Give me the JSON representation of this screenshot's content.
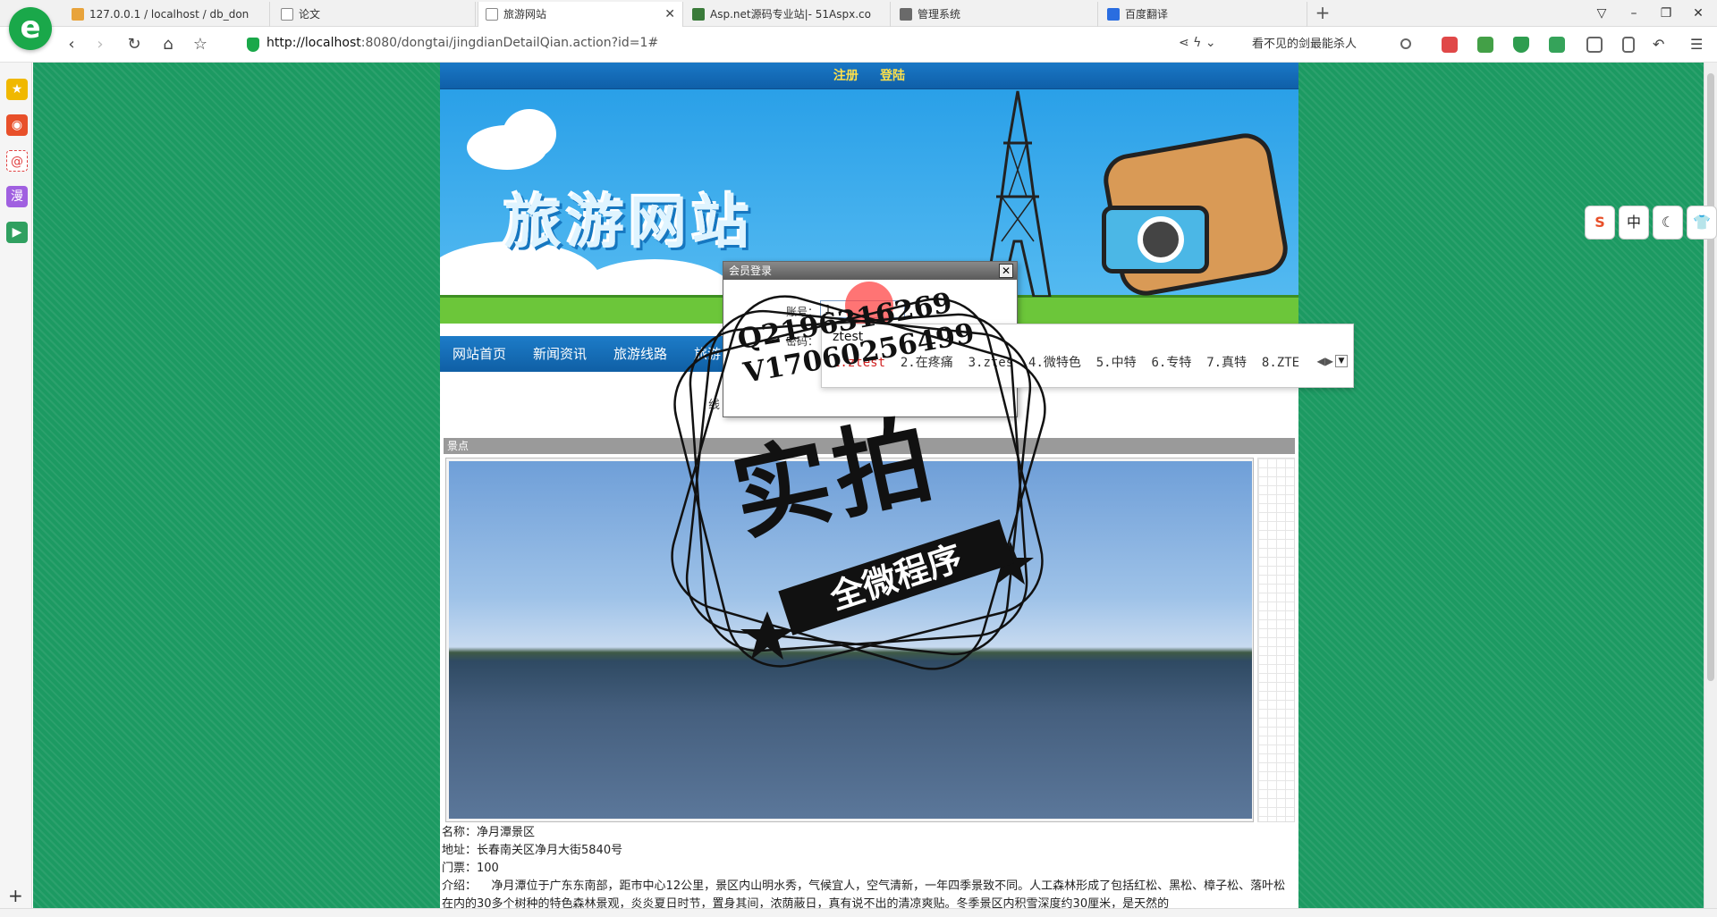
{
  "browser": {
    "tabs": [
      {
        "label": "127.0.0.1 / localhost / db_don",
        "icon": "phpmyadmin-icon",
        "color": "#e8a33b"
      },
      {
        "label": "论文",
        "icon": "document-icon",
        "color": "#9a9a9a"
      },
      {
        "label": "旅游网站",
        "icon": "document-icon",
        "color": "#9a9a9a"
      },
      {
        "label": "Asp.net源码专业站|- 51Aspx.co",
        "icon": "aspx-icon",
        "color": "#3a7b3a"
      },
      {
        "label": "管理系统",
        "icon": "chart-icon",
        "color": "#6a6a6a"
      },
      {
        "label": "百度翻译",
        "icon": "baidu-translate-icon",
        "color": "#2a6de0"
      }
    ],
    "url_host": "http://localhost",
    "url_rest": ":8080/dongtai/jingdianDetailQian.action?id=1#",
    "search_text": "看不见的剑最能杀人"
  },
  "sidebar": {
    "items": [
      {
        "name": "favorites-star-icon",
        "glyph": "★",
        "color": "#f0b800"
      },
      {
        "name": "weibo-icon",
        "glyph": "◉",
        "color": "#e8502a"
      },
      {
        "name": "mail-at-icon",
        "glyph": "@",
        "color": "#e04040"
      },
      {
        "name": "comic-icon",
        "glyph": "漫",
        "color": "#a060e0"
      },
      {
        "name": "video-icon",
        "glyph": "▶",
        "color": "#30a060"
      }
    ]
  },
  "site": {
    "topbar": {
      "register": "注册",
      "login": "登陆"
    },
    "banner_title": "旅游网站",
    "nav": [
      "网站首页",
      "新闻资讯",
      "旅游线路",
      "旅游"
    ],
    "nav_note": "线",
    "section_title": "景点",
    "details": {
      "name_label": "名称：",
      "name": "净月潭景区",
      "address_label": "地址：",
      "address": "长春南关区净月大街5840号",
      "ticket_label": "门票：",
      "ticket": "100",
      "intro_label": "介绍：",
      "intro": "净月潭位于广东东南部，距市中心12公里，景区内山明水秀，气候宜人，空气清新，一年四季景致不同。人工森林形成了包括红松、黑松、樟子松、落叶松在内的30多个树种的特色森林景观，炎炎夏日时节，置身其间，浓荫蔽日，真有说不出的清凉爽贴。冬季景区内积雪深度约30厘米，是天然的"
    }
  },
  "dialog": {
    "title": "会员登录",
    "account_label": "账号：",
    "account_value": "1",
    "password_label": "密码："
  },
  "ime": {
    "composition": "ztest",
    "candidates": [
      "1.ztest",
      "2.在疼痛",
      "3.ztes",
      "4.微特色",
      "5.中特",
      "6.专特",
      "7.真特",
      "8.ZTE"
    ]
  },
  "lang_toolbar": [
    "S",
    "中",
    "☾",
    "👕"
  ],
  "watermark": {
    "line1": "Q2196316269",
    "line2": "V17060256499",
    "big": "实拍",
    "ribbon": "全微程序"
  }
}
